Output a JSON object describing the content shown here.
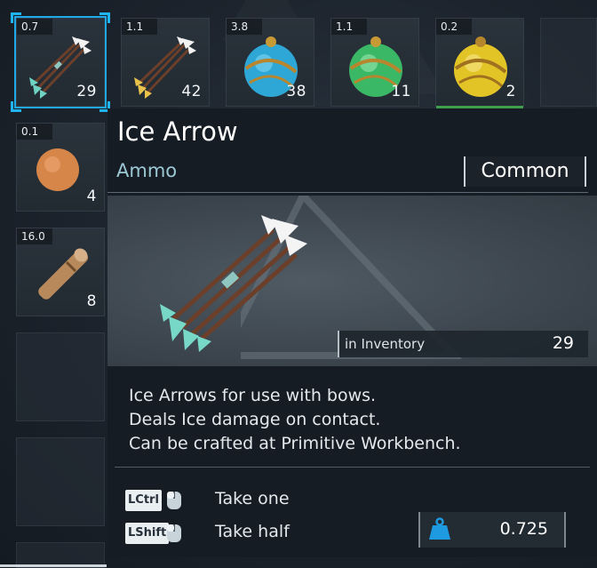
{
  "inventory": {
    "slots": [
      {
        "weight": "0.7",
        "qty": "29",
        "item": "ice-arrow"
      },
      {
        "weight": "1.1",
        "qty": "42",
        "item": "shock-arrow"
      },
      {
        "weight": "3.8",
        "qty": "38",
        "item": "aqua-sphere"
      },
      {
        "weight": "1.1",
        "qty": "11",
        "item": "green-sphere"
      },
      {
        "weight": "0.2",
        "qty": "2",
        "item": "gold-sphere"
      },
      {
        "weight": "0.1",
        "qty": "4",
        "item": "round-food"
      },
      {
        "weight": "16.0",
        "qty": "8",
        "item": "wooden-log"
      }
    ]
  },
  "tooltip": {
    "title": "Ice Arrow",
    "category": "Ammo",
    "rarity": "Common",
    "in_inventory_label": "in Inventory",
    "in_inventory_value": "29",
    "description": [
      "Ice Arrows for use with bows.",
      "Deals Ice damage on contact.",
      "Can be crafted at Primitive Workbench."
    ],
    "hints": [
      {
        "key": "LCtrl",
        "label": "Take one"
      },
      {
        "key": "LShift",
        "label": "Take half"
      }
    ],
    "weight_value": "0.725"
  },
  "colors": {
    "selection": "#1fa9e8",
    "title": "#ffffff",
    "category": "#9cc8d6",
    "weight_icon": "#1e9ae0"
  }
}
